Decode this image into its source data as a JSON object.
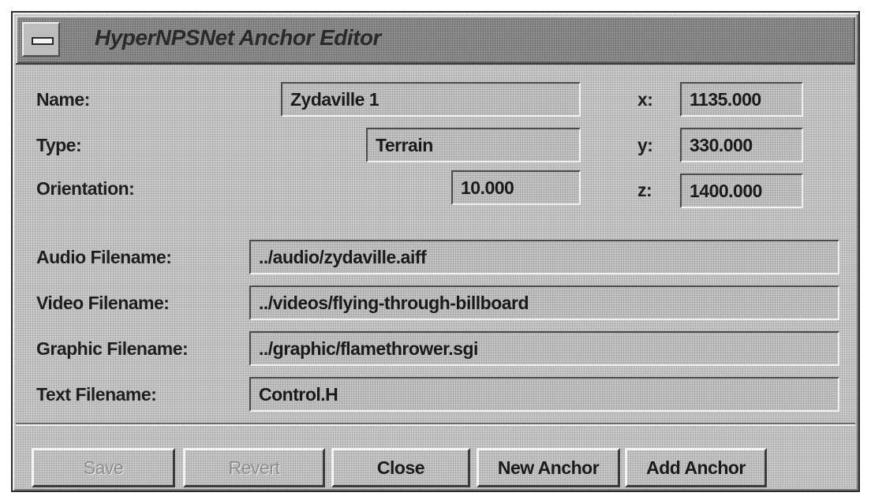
{
  "window": {
    "title": "HyperNPSNet Anchor Editor"
  },
  "form": {
    "name": {
      "label": "Name:",
      "value": "Zydaville 1"
    },
    "type": {
      "label": "Type:",
      "value": "Terrain"
    },
    "orientation": {
      "label": "Orientation:",
      "value": "10.000"
    },
    "x": {
      "label": "x:",
      "value": "1135.000"
    },
    "y": {
      "label": "y:",
      "value": "330.000"
    },
    "z": {
      "label": "z:",
      "value": "1400.000"
    },
    "audio": {
      "label": "Audio Filename:",
      "value": "../audio/zydaville.aiff"
    },
    "video": {
      "label": "Video Filename:",
      "value": "../videos/flying-through-billboard"
    },
    "graphic": {
      "label": "Graphic Filename:",
      "value": "../graphic/flamethrower.sgi"
    },
    "text": {
      "label": "Text Filename:",
      "value": "Control.H"
    }
  },
  "buttons": {
    "save": "Save",
    "revert": "Revert",
    "close": "Close",
    "new_anchor": "New Anchor",
    "add_anchor": "Add Anchor"
  }
}
